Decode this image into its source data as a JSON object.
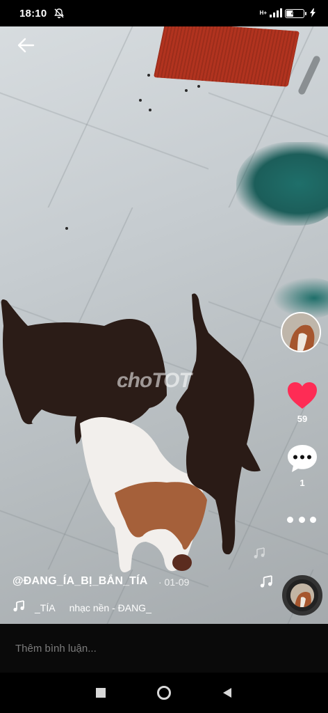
{
  "status": {
    "time": "18:10",
    "network": "H+",
    "battery": "40",
    "battery_level": 0.4
  },
  "video": {
    "watermark": "choTOT"
  },
  "actions": {
    "like_count": "59",
    "comment_count": "1"
  },
  "caption": {
    "username": "@ĐANG_ÍA_BỊ_BẮN_TÍA",
    "date": "· 01-09",
    "sound_short": "_TÍA",
    "sound_title": "nhạc nền - ĐANG_"
  },
  "comment": {
    "placeholder": "Thêm bình luận..."
  },
  "colors": {
    "like": "#fe2c55",
    "background": "#000000"
  }
}
